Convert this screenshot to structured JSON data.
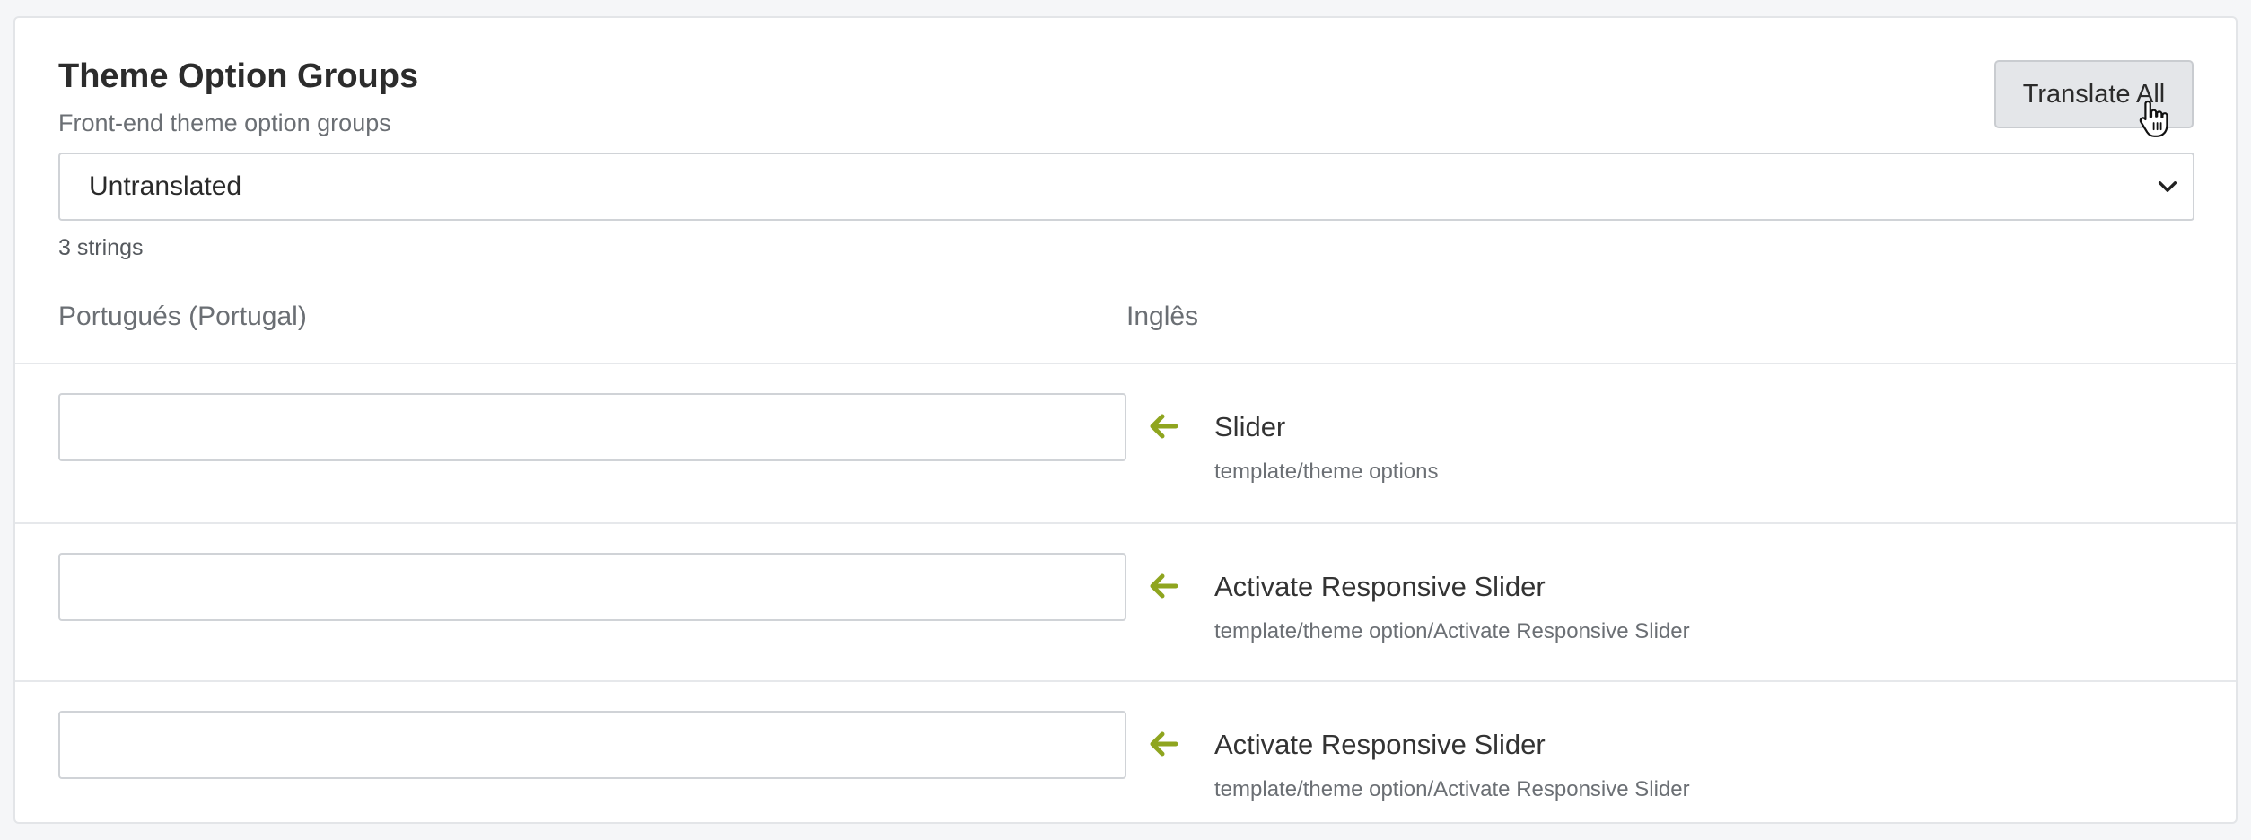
{
  "section": {
    "title": "Theme Option Groups",
    "subtitle": "Front-end theme option groups",
    "translate_all_label": "Translate All"
  },
  "filter": {
    "selected": "Untranslated"
  },
  "strings_count": "3 strings",
  "columns": {
    "target_language": "Portugués (Portugal)",
    "source_language": "Inglês"
  },
  "rows": [
    {
      "source": "Slider",
      "context": "template/theme options",
      "translation": ""
    },
    {
      "source": "Activate Responsive Slider",
      "context": "template/theme option/Activate Responsive Slider",
      "translation": ""
    },
    {
      "source": "Activate Responsive Slider",
      "context": "template/theme option/Activate Responsive Slider",
      "translation": ""
    }
  ],
  "colors": {
    "accent_arrow": "#8fa51f",
    "button_bg": "#e4e6e9",
    "panel_bg": "#ffffff",
    "page_bg": "#f5f6f8"
  },
  "icons": {
    "copy_arrow": "arrow-left-icon",
    "dropdown": "chevron-down-icon",
    "pointer": "hand-cursor-icon"
  }
}
